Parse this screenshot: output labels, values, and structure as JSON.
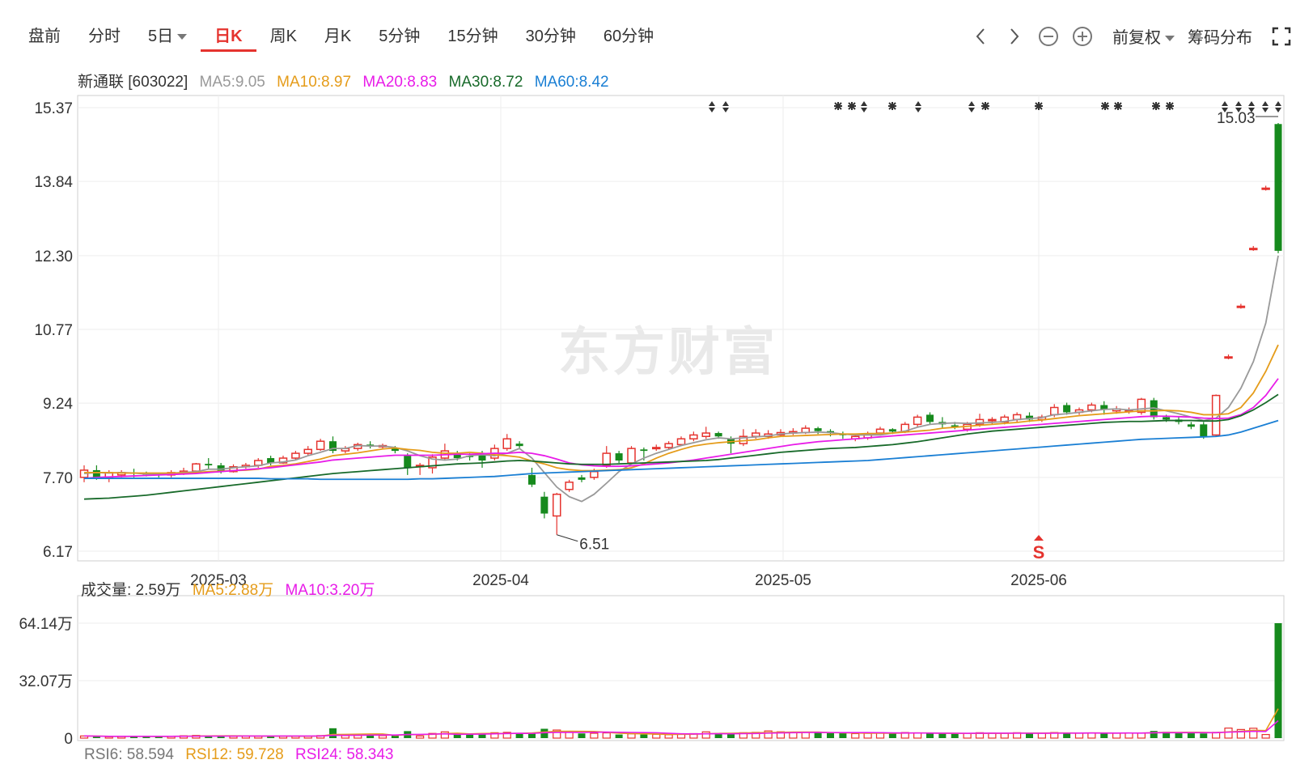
{
  "toolbar": {
    "tabs": [
      {
        "label": "盘前"
      },
      {
        "label": "分时"
      },
      {
        "label": "5日"
      },
      {
        "label": "日K"
      },
      {
        "label": "周K"
      },
      {
        "label": "月K"
      },
      {
        "label": "5分钟"
      },
      {
        "label": "15分钟"
      },
      {
        "label": "30分钟"
      },
      {
        "label": "60分钟"
      }
    ],
    "active_tab": "日K",
    "adjust_label": "前复权",
    "chip_label": "筹码分布",
    "icons": [
      "chevron-left-icon",
      "chevron-right-icon",
      "zoom-out-icon",
      "zoom-in-icon",
      "fullscreen-icon"
    ]
  },
  "legend": {
    "stock": "新通联 [603022]",
    "ma5": "MA5:9.05",
    "ma10": "MA10:8.97",
    "ma20": "MA20:8.83",
    "ma30": "MA30:8.72",
    "ma60": "MA60:8.42"
  },
  "volume_legend": {
    "vol": "成交量: 2.59万",
    "ma5": "MA5:2.88万",
    "ma10": "MA10:3.20万"
  },
  "rsi_legend": {
    "rsi6": "RSI6: 58.594",
    "rsi12": "RSI12: 59.728",
    "rsi24": "RSI24: 58.343"
  },
  "watermark": "东方财富",
  "colors": {
    "up": "#e5332e",
    "down": "#168a1d",
    "ma5": "#999999",
    "ma10": "#e59c1a",
    "ma20": "#e81ce8",
    "ma30": "#186a2a",
    "ma60": "#1a7fd4"
  },
  "chart_data": {
    "type": "candlestick",
    "price_ticks": [
      "15.37",
      "13.84",
      "12.30",
      "10.77",
      "9.24",
      "7.70",
      "6.17"
    ],
    "ylim": [
      6.17,
      15.37
    ],
    "x_ticks": [
      "2025-03",
      "2025-04",
      "2025-05",
      "2025-06"
    ],
    "low_label": "6.51",
    "high_label": "15.03",
    "signal_label": "S",
    "volume_ticks": [
      "64.14万",
      "32.07万",
      "0"
    ],
    "volume_ylim": [
      0,
      64.14
    ],
    "candles": [
      [
        7.7,
        7.85,
        7.95,
        7.6
      ],
      [
        7.85,
        7.7,
        7.95,
        7.65
      ],
      [
        7.7,
        7.8,
        7.85,
        7.6
      ],
      [
        7.75,
        7.8,
        7.85,
        7.7
      ],
      [
        7.8,
        7.78,
        7.88,
        7.7
      ],
      [
        7.78,
        7.77,
        7.82,
        7.72
      ],
      [
        7.77,
        7.75,
        7.8,
        7.7
      ],
      [
        7.75,
        7.8,
        7.85,
        7.7
      ],
      [
        7.8,
        7.83,
        7.9,
        7.75
      ],
      [
        7.83,
        7.98,
        8.0,
        7.8
      ],
      [
        7.98,
        7.95,
        8.1,
        7.88
      ],
      [
        7.95,
        7.82,
        8.0,
        7.78
      ],
      [
        7.82,
        7.92,
        7.97,
        7.8
      ],
      [
        7.92,
        7.95,
        8.0,
        7.88
      ],
      [
        7.95,
        8.05,
        8.1,
        7.9
      ],
      [
        8.1,
        8.0,
        8.15,
        7.95
      ],
      [
        8.0,
        8.1,
        8.15,
        7.98
      ],
      [
        8.1,
        8.2,
        8.25,
        8.05
      ],
      [
        8.2,
        8.28,
        8.35,
        8.15
      ],
      [
        8.28,
        8.45,
        8.5,
        8.25
      ],
      [
        8.45,
        8.25,
        8.55,
        8.2
      ],
      [
        8.25,
        8.3,
        8.35,
        8.2
      ],
      [
        8.3,
        8.38,
        8.42,
        8.25
      ],
      [
        8.38,
        8.35,
        8.45,
        8.3
      ],
      [
        8.35,
        8.36,
        8.4,
        8.3
      ],
      [
        8.3,
        8.25,
        8.35,
        8.2
      ],
      [
        8.15,
        7.9,
        8.2,
        7.75
      ],
      [
        7.95,
        7.95,
        8.0,
        7.75
      ],
      [
        7.9,
        8.12,
        8.18,
        7.78
      ],
      [
        8.1,
        8.25,
        8.4,
        8.05
      ],
      [
        8.2,
        8.1,
        8.25,
        8.05
      ],
      [
        8.15,
        8.12,
        8.2,
        8.05
      ],
      [
        8.2,
        8.05,
        8.25,
        7.9
      ],
      [
        8.1,
        8.3,
        8.38,
        8.05
      ],
      [
        8.3,
        8.5,
        8.6,
        8.25
      ],
      [
        8.4,
        8.35,
        8.45,
        8.3
      ],
      [
        7.75,
        7.55,
        7.9,
        7.5
      ],
      [
        7.3,
        6.95,
        7.4,
        6.85
      ],
      [
        6.9,
        7.35,
        7.38,
        6.51
      ],
      [
        7.45,
        7.6,
        7.65,
        7.4
      ],
      [
        7.7,
        7.65,
        7.75,
        7.6
      ],
      [
        7.7,
        7.82,
        7.88,
        7.65
      ],
      [
        7.95,
        8.2,
        8.35,
        7.9
      ],
      [
        8.2,
        8.05,
        8.25,
        8.0
      ],
      [
        8.0,
        8.3,
        8.35,
        7.98
      ],
      [
        8.28,
        8.25,
        8.32,
        8.05
      ],
      [
        8.3,
        8.32,
        8.38,
        8.25
      ],
      [
        8.32,
        8.4,
        8.45,
        8.28
      ],
      [
        8.38,
        8.5,
        8.55,
        8.35
      ],
      [
        8.5,
        8.58,
        8.65,
        8.45
      ],
      [
        8.55,
        8.62,
        8.75,
        8.5
      ],
      [
        8.62,
        8.55,
        8.65,
        8.5
      ],
      [
        8.5,
        8.4,
        8.55,
        8.2
      ],
      [
        8.4,
        8.55,
        8.7,
        8.35
      ],
      [
        8.55,
        8.62,
        8.7,
        8.5
      ],
      [
        8.55,
        8.6,
        8.68,
        8.5
      ],
      [
        8.58,
        8.63,
        8.7,
        8.55
      ],
      [
        8.62,
        8.65,
        8.72,
        8.58
      ],
      [
        8.63,
        8.72,
        8.78,
        8.6
      ],
      [
        8.72,
        8.66,
        8.75,
        8.6
      ],
      [
        8.66,
        8.62,
        8.7,
        8.55
      ],
      [
        8.6,
        8.58,
        8.65,
        8.5
      ],
      [
        8.5,
        8.55,
        8.6,
        8.45
      ],
      [
        8.52,
        8.6,
        8.65,
        8.48
      ],
      [
        8.62,
        8.7,
        8.75,
        8.58
      ],
      [
        8.7,
        8.65,
        8.72,
        8.6
      ],
      [
        8.65,
        8.8,
        8.85,
        8.62
      ],
      [
        8.8,
        8.95,
        9.0,
        8.75
      ],
      [
        9.0,
        8.85,
        9.05,
        8.8
      ],
      [
        8.85,
        8.8,
        8.95,
        8.72
      ],
      [
        8.78,
        8.75,
        8.85,
        8.7
      ],
      [
        8.7,
        8.8,
        8.85,
        8.65
      ],
      [
        8.8,
        8.9,
        9.02,
        8.75
      ],
      [
        8.88,
        8.9,
        8.95,
        8.8
      ],
      [
        8.85,
        8.95,
        9.0,
        8.8
      ],
      [
        8.9,
        9.0,
        9.05,
        8.85
      ],
      [
        8.98,
        8.9,
        9.05,
        8.85
      ],
      [
        8.9,
        8.95,
        9.0,
        8.85
      ],
      [
        9.0,
        9.15,
        9.22,
        8.95
      ],
      [
        9.2,
        9.05,
        9.25,
        9.0
      ],
      [
        9.05,
        9.1,
        9.15,
        9.0
      ],
      [
        9.1,
        9.2,
        9.25,
        9.05
      ],
      [
        9.2,
        9.1,
        9.28,
        9.0
      ],
      [
        9.08,
        9.12,
        9.18,
        9.02
      ],
      [
        9.1,
        9.1,
        9.15,
        9.02
      ],
      [
        9.05,
        9.32,
        9.35,
        9.0
      ],
      [
        9.3,
        8.95,
        9.35,
        8.9
      ],
      [
        8.95,
        8.9,
        9.0,
        8.85
      ],
      [
        8.9,
        8.85,
        8.95,
        8.8
      ],
      [
        8.8,
        8.75,
        8.85,
        8.7
      ],
      [
        8.8,
        8.55,
        8.85,
        8.5
      ],
      [
        8.58,
        9.4,
        9.42,
        8.55
      ],
      [
        10.2,
        10.2,
        10.25,
        10.15
      ],
      [
        11.25,
        11.25,
        11.3,
        11.2
      ],
      [
        12.45,
        12.45,
        12.5,
        12.4
      ],
      [
        13.7,
        13.7,
        13.75,
        13.65
      ],
      [
        15.03,
        12.4,
        15.05,
        12.35
      ]
    ],
    "volume": [
      1.2,
      1.0,
      0.8,
      0.9,
      1.0,
      1.1,
      0.9,
      1.0,
      1.3,
      1.5,
      1.4,
      1.2,
      1.0,
      1.1,
      1.0,
      1.2,
      1.1,
      1.0,
      1.0,
      1.4,
      5.5,
      1.4,
      1.5,
      1.6,
      1.4,
      1.5,
      3.9,
      1.2,
      2.6,
      3.5,
      2.5,
      2.0,
      2.2,
      3.0,
      3.2,
      2.8,
      3.0,
      5.2,
      4.5,
      3.5,
      2.6,
      2.7,
      2.9,
      2.0,
      2.4,
      2.0,
      2.1,
      1.9,
      2.2,
      2.5,
      3.5,
      2.9,
      2.4,
      3.0,
      3.2,
      4.0,
      3.5,
      3.0,
      3.2,
      3.0,
      2.8,
      2.7,
      2.5,
      2.7,
      3.0,
      2.7,
      3.1,
      2.9,
      2.6,
      2.5,
      2.4,
      2.6,
      3.0,
      2.8,
      2.7,
      3.0,
      2.6,
      2.8,
      3.1,
      2.7,
      2.8,
      2.9,
      2.7,
      2.8,
      2.9,
      2.8,
      4.0,
      3.5,
      2.9,
      3.0,
      2.6,
      3.2,
      5.6,
      4.8,
      5.5,
      2.0,
      64.14
    ],
    "ma_series": [
      {
        "name": "MA5",
        "values": [
          7.78,
          7.8,
          7.79,
          7.8,
          7.79,
          7.77,
          7.77,
          7.79,
          7.8,
          7.82,
          7.87,
          7.87,
          7.9,
          7.92,
          7.94,
          8.0,
          8.02,
          8.06,
          8.15,
          8.22,
          8.3,
          8.3,
          8.36,
          8.35,
          8.35,
          8.32,
          8.25,
          8.15,
          8.08,
          8.06,
          8.08,
          8.15,
          8.17,
          8.15,
          8.2,
          8.3,
          8.1,
          7.8,
          7.5,
          7.3,
          7.2,
          7.35,
          7.58,
          7.82,
          7.98,
          8.1,
          8.2,
          8.28,
          8.36,
          8.42,
          8.48,
          8.52,
          8.5,
          8.52,
          8.54,
          8.56,
          8.6,
          8.62,
          8.63,
          8.64,
          8.63,
          8.6,
          8.58,
          8.58,
          8.58,
          8.62,
          8.66,
          8.74,
          8.8,
          8.82,
          8.83,
          8.82,
          8.83,
          8.84,
          8.86,
          8.9,
          8.92,
          8.94,
          9.0,
          9.02,
          9.05,
          9.08,
          9.11,
          9.12,
          9.1,
          9.12,
          9.14,
          9.08,
          9.02,
          8.95,
          8.88,
          8.93,
          9.15,
          9.55,
          10.1,
          10.9,
          12.3
        ]
      },
      {
        "name": "MA10",
        "values": [
          7.8,
          7.8,
          7.8,
          7.79,
          7.79,
          7.79,
          7.79,
          7.79,
          7.79,
          7.8,
          7.82,
          7.83,
          7.84,
          7.85,
          7.87,
          7.93,
          7.95,
          7.98,
          8.03,
          8.08,
          8.15,
          8.18,
          8.21,
          8.25,
          8.29,
          8.31,
          8.28,
          8.26,
          8.22,
          8.2,
          8.2,
          8.22,
          8.2,
          8.17,
          8.15,
          8.12,
          8.04,
          7.98,
          7.9,
          7.86,
          7.84,
          7.84,
          7.85,
          7.86,
          7.9,
          7.98,
          8.1,
          8.2,
          8.28,
          8.35,
          8.39,
          8.42,
          8.44,
          8.46,
          8.48,
          8.52,
          8.55,
          8.56,
          8.57,
          8.58,
          8.59,
          8.6,
          8.6,
          8.61,
          8.61,
          8.62,
          8.64,
          8.66,
          8.68,
          8.72,
          8.74,
          8.76,
          8.78,
          8.8,
          8.82,
          8.84,
          8.87,
          8.89,
          8.92,
          8.95,
          8.98,
          9.0,
          9.02,
          9.04,
          9.06,
          9.08,
          9.08,
          9.09,
          9.08,
          9.05,
          9.0,
          9.0,
          9.02,
          9.15,
          9.45,
          9.9,
          10.45
        ]
      },
      {
        "name": "MA20",
        "values": [
          7.68,
          7.7,
          7.71,
          7.72,
          7.73,
          7.74,
          7.75,
          7.76,
          7.77,
          7.78,
          7.8,
          7.82,
          7.84,
          7.86,
          7.88,
          7.9,
          7.93,
          7.96,
          7.99,
          8.02,
          8.06,
          8.08,
          8.1,
          8.12,
          8.14,
          8.16,
          8.16,
          8.16,
          8.16,
          8.17,
          8.18,
          8.18,
          8.19,
          8.2,
          8.2,
          8.22,
          8.2,
          8.15,
          8.08,
          8.0,
          7.96,
          7.94,
          7.93,
          7.93,
          7.94,
          7.96,
          7.98,
          8.0,
          8.03,
          8.06,
          8.1,
          8.14,
          8.18,
          8.22,
          8.26,
          8.3,
          8.34,
          8.38,
          8.41,
          8.44,
          8.46,
          8.48,
          8.5,
          8.52,
          8.54,
          8.56,
          8.58,
          8.6,
          8.62,
          8.64,
          8.66,
          8.68,
          8.7,
          8.72,
          8.74,
          8.76,
          8.78,
          8.8,
          8.82,
          8.84,
          8.86,
          8.88,
          8.9,
          8.92,
          8.94,
          8.96,
          8.97,
          8.97,
          8.96,
          8.95,
          8.93,
          8.92,
          8.93,
          9.0,
          9.15,
          9.4,
          9.75
        ]
      },
      {
        "name": "MA30",
        "values": [
          7.25,
          7.26,
          7.27,
          7.29,
          7.31,
          7.33,
          7.36,
          7.39,
          7.42,
          7.45,
          7.48,
          7.51,
          7.54,
          7.57,
          7.6,
          7.63,
          7.66,
          7.69,
          7.72,
          7.75,
          7.78,
          7.8,
          7.82,
          7.84,
          7.86,
          7.88,
          7.9,
          7.92,
          7.94,
          7.96,
          7.98,
          7.99,
          8.0,
          8.02,
          8.04,
          8.05,
          8.04,
          8.02,
          8.0,
          7.98,
          7.97,
          7.97,
          7.97,
          7.98,
          7.99,
          8.0,
          8.01,
          8.02,
          8.03,
          8.04,
          8.05,
          8.07,
          8.1,
          8.13,
          8.16,
          8.19,
          8.22,
          8.24,
          8.26,
          8.28,
          8.3,
          8.31,
          8.32,
          8.34,
          8.36,
          8.38,
          8.41,
          8.44,
          8.48,
          8.52,
          8.56,
          8.6,
          8.63,
          8.66,
          8.68,
          8.7,
          8.72,
          8.74,
          8.76,
          8.78,
          8.8,
          8.82,
          8.84,
          8.85,
          8.86,
          8.86,
          8.87,
          8.88,
          8.88,
          8.88,
          8.87,
          8.87,
          8.9,
          8.98,
          9.1,
          9.25,
          9.42
        ]
      },
      {
        "name": "MA60",
        "values": [
          7.68,
          7.68,
          7.68,
          7.68,
          7.68,
          7.68,
          7.68,
          7.68,
          7.68,
          7.68,
          7.68,
          7.68,
          7.68,
          7.68,
          7.68,
          7.67,
          7.67,
          7.67,
          7.67,
          7.66,
          7.66,
          7.66,
          7.66,
          7.66,
          7.66,
          7.66,
          7.66,
          7.67,
          7.67,
          7.68,
          7.69,
          7.7,
          7.71,
          7.72,
          7.74,
          7.76,
          7.78,
          7.79,
          7.8,
          7.81,
          7.82,
          7.83,
          7.84,
          7.85,
          7.86,
          7.87,
          7.88,
          7.89,
          7.9,
          7.91,
          7.92,
          7.93,
          7.94,
          7.95,
          7.96,
          7.97,
          7.98,
          7.99,
          8.0,
          8.01,
          8.02,
          8.03,
          8.04,
          8.05,
          8.07,
          8.09,
          8.11,
          8.13,
          8.15,
          8.17,
          8.19,
          8.21,
          8.23,
          8.25,
          8.27,
          8.29,
          8.31,
          8.33,
          8.35,
          8.37,
          8.39,
          8.41,
          8.43,
          8.45,
          8.47,
          8.49,
          8.5,
          8.51,
          8.52,
          8.53,
          8.54,
          8.55,
          8.58,
          8.64,
          8.72,
          8.8,
          8.88
        ]
      }
    ]
  }
}
